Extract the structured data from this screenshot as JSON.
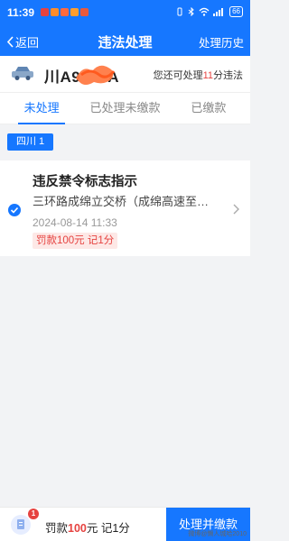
{
  "status_bar": {
    "time": "11:39",
    "battery": "66"
  },
  "nav": {
    "back_label": "返回",
    "title": "违法处理",
    "history_label": "处理历史"
  },
  "plate": {
    "number_visible": "川A9",
    "suffix_visible": "A",
    "remain_prefix": "您还可处理",
    "remain_count": "11",
    "remain_suffix": "分违法"
  },
  "tabs": [
    {
      "label": "未处理",
      "active": true
    },
    {
      "label": "已处理未缴款",
      "active": false
    },
    {
      "label": "已缴款",
      "active": false
    }
  ],
  "region_label": "四川 1",
  "violations": [
    {
      "title": "违反禁令标志指示",
      "location": "三环路成绵立交桥（成绵高速至…",
      "time": "2024-08-14 11:33",
      "fine": "罚款100元 记1分",
      "selected": true
    }
  ],
  "bottom": {
    "badge_count": "1",
    "summary_prefix": "罚款",
    "summary_amount": "100",
    "summary_suffix": "元 记1分",
    "pay_button": "处理并缴款"
  },
  "watermark": "微博@懒人城哈2010",
  "colors": {
    "primary": "#1677ff",
    "danger": "#e64340",
    "background": "#f2f3f5"
  },
  "icons": [
    "back-chevron-icon",
    "car-icon",
    "check-circle-icon",
    "chevron-right-icon",
    "document-icon",
    "wifi-icon",
    "signal-icon",
    "battery-icon"
  ]
}
